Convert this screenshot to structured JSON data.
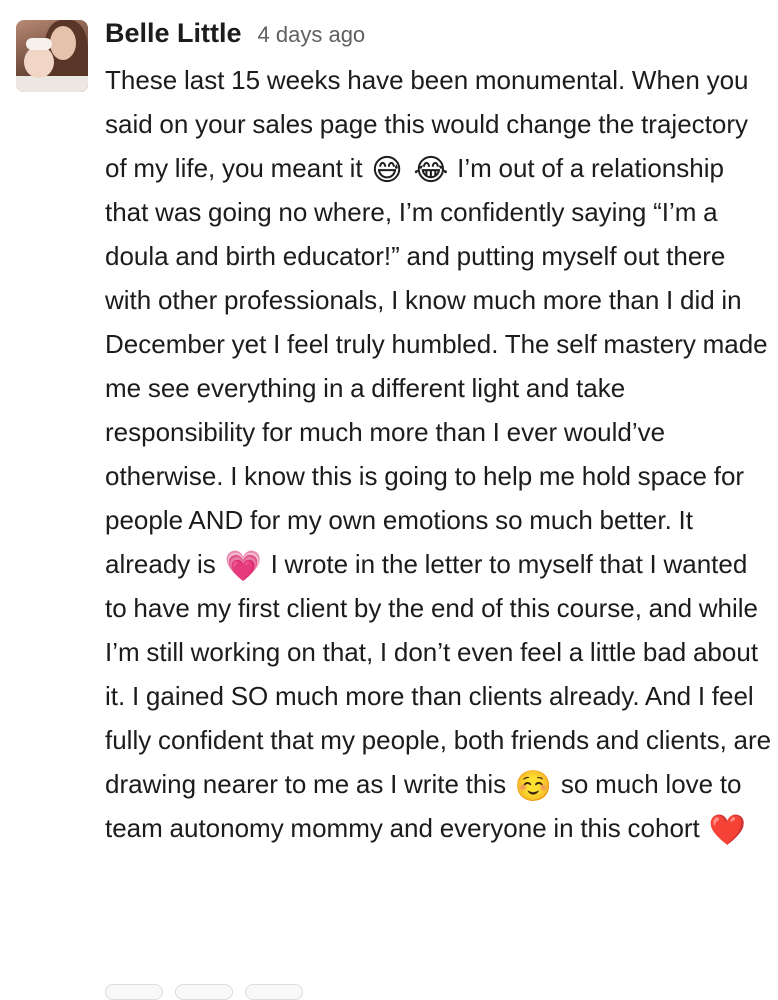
{
  "message": {
    "author": "Belle Little",
    "timestamp": "4 days ago",
    "segments": [
      {
        "type": "text",
        "value": "These last 15 weeks have been monumental. When you said on your sales page this would change the trajectory of my life, you meant it "
      },
      {
        "type": "emoji",
        "value": "😅",
        "name": "grinning-sweat-emoji"
      },
      {
        "type": "text",
        "value": " "
      },
      {
        "type": "emoji",
        "value": "😂",
        "name": "tears-of-joy-emoji"
      },
      {
        "type": "text",
        "value": " I’m out of a relationship that was going no where, I’m confidently saying “I’m a doula and birth educator!” and putting myself out there with other professionals, I know much more than I did in December yet I feel truly humbled. The self mastery made me see everything in a different light and take responsibility for much more than I ever would’ve otherwise. I know this is going to help me hold space for people AND for my own emotions so much better. It already is "
      },
      {
        "type": "emoji",
        "value": "💗",
        "name": "growing-heart-emoji"
      },
      {
        "type": "text",
        "value": "  I wrote in the letter to myself that I wanted to have my first client by the end of this course, and while I’m still working on that, I don’t even feel a little bad about it. I gained SO much more than clients already. And I feel fully confident that my people, both friends and clients, are drawing nearer to me as I write this "
      },
      {
        "type": "emoji",
        "value": "☺️",
        "name": "smiling-face-emoji"
      },
      {
        "type": "text",
        "value": "  so much love to team autonomy mommy and everyone in this cohort "
      },
      {
        "type": "emoji",
        "value": "❤️",
        "name": "red-heart-emoji"
      }
    ]
  },
  "colors": {
    "author": "#1d1c1d",
    "timestamp": "#616061",
    "text": "#1d1c1d",
    "background": "#ffffff"
  }
}
